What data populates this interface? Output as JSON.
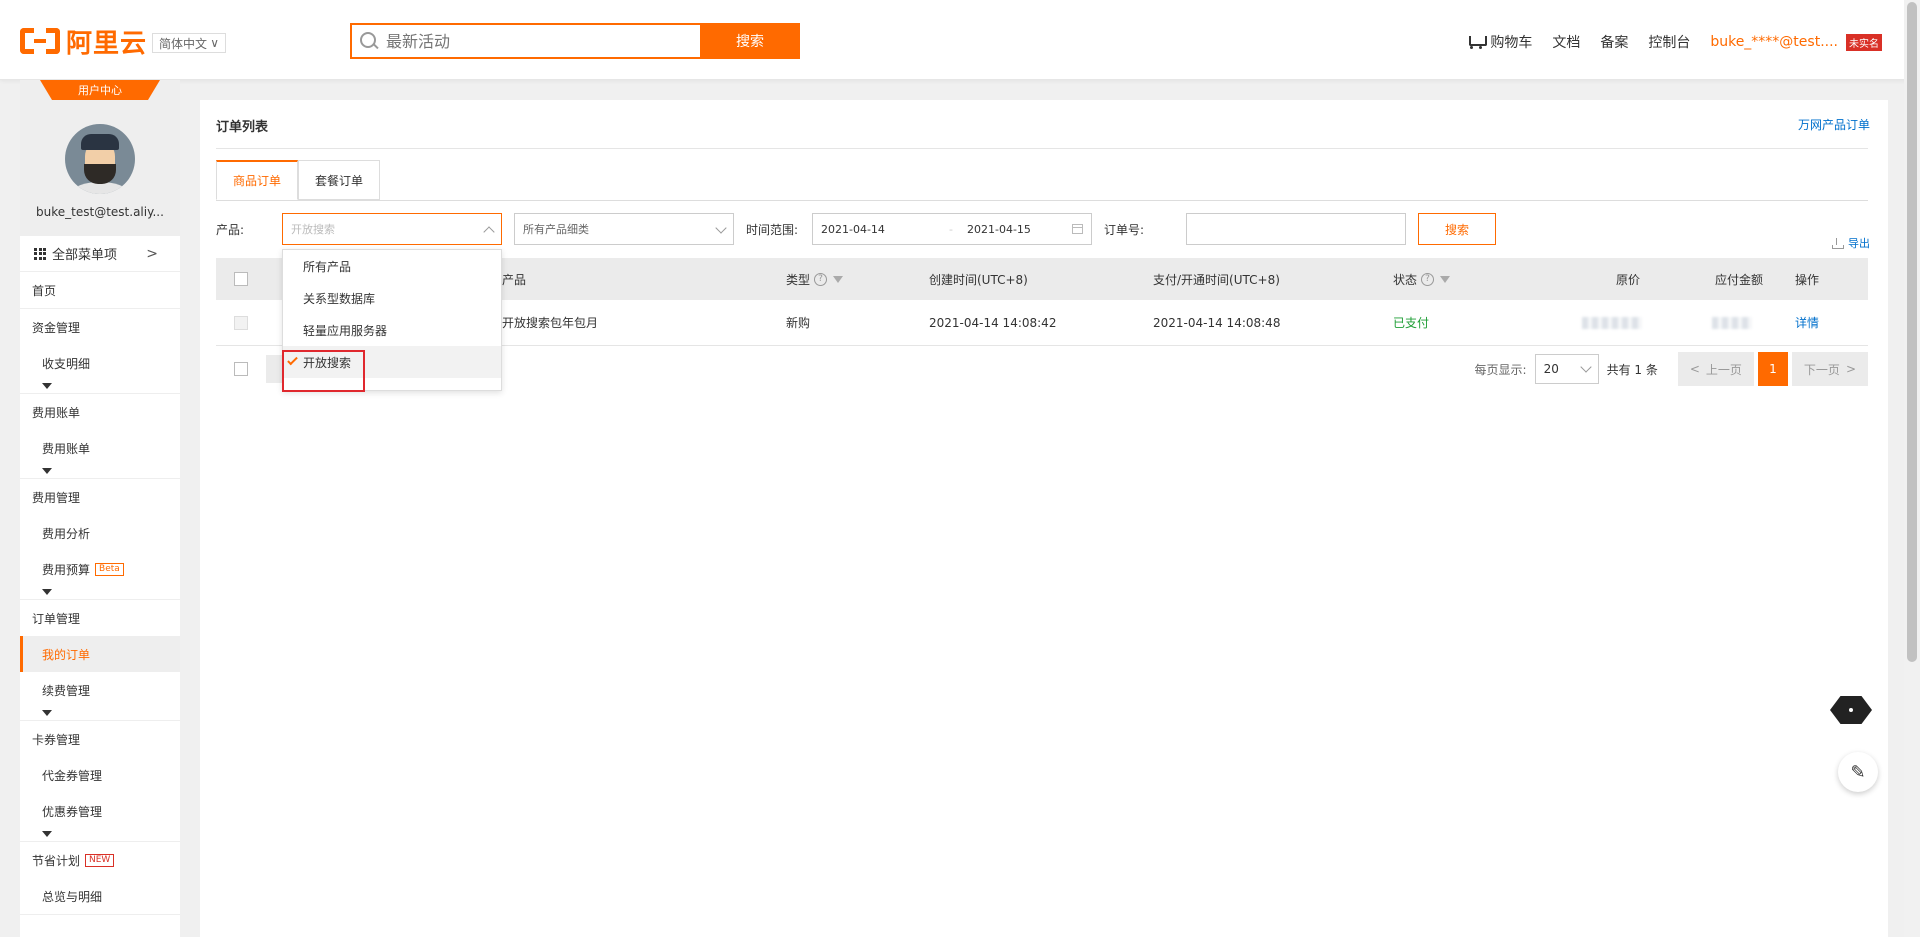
{
  "header": {
    "logo_text": "阿里云",
    "lang": "简体中文",
    "search_placeholder": "最新活动",
    "search_button": "搜索",
    "nav": {
      "cart": "购物车",
      "docs": "文档",
      "beian": "备案",
      "console": "控制台",
      "user": "buke_****@test....",
      "badge": "未实名"
    }
  },
  "sidebar": {
    "tab": "用户中心",
    "username": "buke_test@test.aliy...",
    "all_menu": "全部菜单项",
    "menu": {
      "home": "首页",
      "fund": "资金管理",
      "fund_detail": "收支明细",
      "bill": "费用账单",
      "bill_item": "费用账单",
      "cost": "费用管理",
      "cost_analysis": "费用分析",
      "cost_budget": "费用预算",
      "beta": "Beta",
      "order": "订单管理",
      "my_order": "我的订单",
      "renew": "续费管理",
      "coupon": "卡券管理",
      "voucher": "代金券管理",
      "discount": "优惠券管理",
      "save_plan": "节省计划",
      "new": "NEW",
      "overview": "总览与明细"
    }
  },
  "main": {
    "title": "订单列表",
    "top_link": "万网产品订单",
    "tabs": [
      "商品订单",
      "套餐订单"
    ],
    "filters": {
      "product_label": "产品:",
      "product_value": "开放搜索",
      "category_value": "所有产品细类",
      "time_label": "时间范围:",
      "date_start": "2021-04-14",
      "date_end": "2021-04-15",
      "order_label": "订单号:",
      "order_value": "",
      "search_button": "搜索"
    },
    "export": "导出",
    "table": {
      "headers": {
        "product": "产品",
        "type": "类型",
        "created": "创建时间(UTC+8)",
        "paid_time": "支付/开通时间(UTC+8)",
        "status": "状态",
        "orig_price": "原价",
        "pay_amount": "应付金额",
        "action": "操作"
      },
      "rows": [
        {
          "product": "开放搜索包年包月",
          "type": "新购",
          "created": "2021-04-14 14:08:42",
          "paid_time": "2021-04-14 14:08:48",
          "status": "已支付",
          "action": "详情"
        }
      ]
    },
    "pager": {
      "per_page_label": "每页显示:",
      "per_page": "20",
      "total": "共有 1 条",
      "prev": "上一页",
      "current": "1",
      "next": "下一页"
    }
  },
  "dropdown": {
    "options": [
      "所有产品",
      "关系型数据库",
      "轻量应用服务器",
      "开放搜索"
    ],
    "selected": "开放搜索"
  },
  "colors": {
    "brand": "#ff6a00",
    "link": "#0070cc",
    "paid": "#1e9e35",
    "highlight": "#e0282e"
  }
}
